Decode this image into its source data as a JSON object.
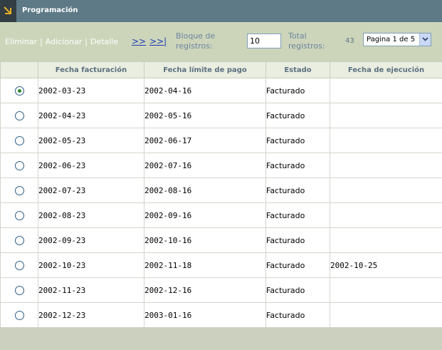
{
  "header": {
    "title": "Programación",
    "icon": "corner-arrow-icon"
  },
  "toolbar": {
    "delete_label": "Eliminar",
    "add_label": "Adicionar",
    "detail_label": "Detalle",
    "separator": "|",
    "next_label": ">>",
    "last_label": ">>|",
    "block_label": "Bloque de registros:",
    "block_value": "10",
    "total_label": "Total registros:",
    "total_value": "43",
    "page_selected": "Pagina 1 de 5"
  },
  "table": {
    "columns": [
      "Fecha facturación",
      "Fecha límite de pago",
      "Estado",
      "Fecha de ejecución"
    ],
    "rows": [
      {
        "selected": true,
        "billing": "2002-03-23",
        "due": "2002-04-16",
        "status": "Facturado",
        "executed": ""
      },
      {
        "selected": false,
        "billing": "2002-04-23",
        "due": "2002-05-16",
        "status": "Facturado",
        "executed": ""
      },
      {
        "selected": false,
        "billing": "2002-05-23",
        "due": "2002-06-17",
        "status": "Facturado",
        "executed": ""
      },
      {
        "selected": false,
        "billing": "2002-06-23",
        "due": "2002-07-16",
        "status": "Facturado",
        "executed": ""
      },
      {
        "selected": false,
        "billing": "2002-07-23",
        "due": "2002-08-16",
        "status": "Facturado",
        "executed": ""
      },
      {
        "selected": false,
        "billing": "2002-08-23",
        "due": "2002-09-16",
        "status": "Facturado",
        "executed": ""
      },
      {
        "selected": false,
        "billing": "2002-09-23",
        "due": "2002-10-16",
        "status": "Facturado",
        "executed": ""
      },
      {
        "selected": false,
        "billing": "2002-10-23",
        "due": "2002-11-18",
        "status": "Facturado",
        "executed": "2002-10-25"
      },
      {
        "selected": false,
        "billing": "2002-11-23",
        "due": "2002-12-16",
        "status": "Facturado",
        "executed": ""
      },
      {
        "selected": false,
        "billing": "2002-12-23",
        "due": "2003-01-16",
        "status": "Facturado",
        "executed": ""
      }
    ]
  },
  "colors": {
    "titlebar": "#5e7a86",
    "toolbar": "#ccd5ba",
    "header_row": "#e9eee0",
    "link": "#1b3bb5",
    "radio_dot": "#2c8a2c"
  }
}
